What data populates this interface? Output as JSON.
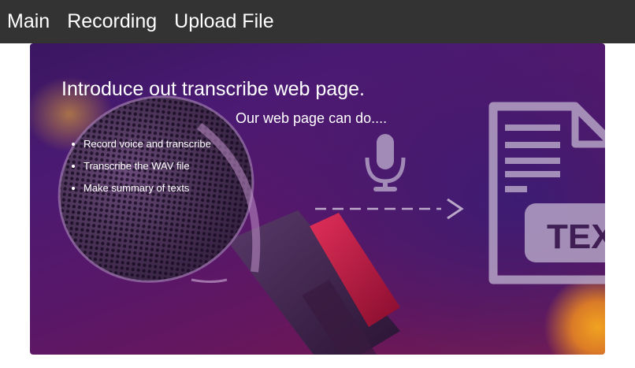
{
  "nav": {
    "items": [
      {
        "label": "Main"
      },
      {
        "label": "Recording"
      },
      {
        "label": "Upload File"
      }
    ]
  },
  "hero": {
    "title": "Introduce out transcribe web page.",
    "subtitle": "Our web page can do....",
    "features": [
      "Record voice and transcribe",
      "Transcribe the WAV file",
      "Make summary of texts"
    ],
    "doc_badge_text": "TEX"
  },
  "colors": {
    "nav_background": "#333333",
    "nav_text": "#ffffff",
    "hero_purple": "#4a1a73",
    "hero_magenta": "#7a1c4e",
    "mic_red_band": "#c8173a",
    "icon_gray": "#b8a8c8",
    "glow_orange": "#f0a320"
  },
  "icons": [
    "microphone-icon",
    "dashed-arrow-icon",
    "document-text-icon"
  ]
}
